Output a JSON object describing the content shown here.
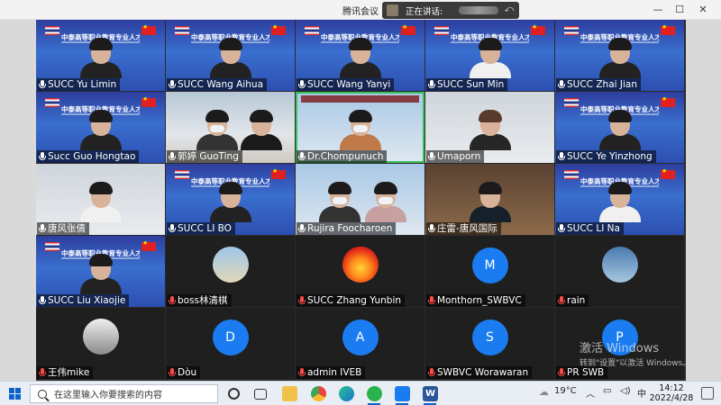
{
  "window": {
    "title": "腾讯会议",
    "speaking_label": "正在讲话:"
  },
  "watermark": {
    "line1": "激活 Windows",
    "line2": "转到\"设置\"以激活 Windows。"
  },
  "banner": {
    "title": "中泰高等职业教育专业人才培养方案研讨会"
  },
  "participants": [
    {
      "name": "SUCC Yu Limin",
      "muted": false
    },
    {
      "name": "SUCC Wang Aihua",
      "muted": false
    },
    {
      "name": "SUCC Wang Yanyi",
      "muted": false
    },
    {
      "name": "SUCC Sun Min",
      "muted": false
    },
    {
      "name": "SUCC Zhai Jian",
      "muted": false
    },
    {
      "name": "Succ Guo Hongtao",
      "muted": false
    },
    {
      "name": "郭婷 GuoTing",
      "muted": false
    },
    {
      "name": "Dr.Chompunuch",
      "muted": false
    },
    {
      "name": "Umaporn",
      "muted": false
    },
    {
      "name": "SUCC Ye Yinzhong",
      "muted": false
    },
    {
      "name": "唐风张倩",
      "muted": false
    },
    {
      "name": "SUCC LI BO",
      "muted": false
    },
    {
      "name": "Rujira Foocharoen",
      "muted": false
    },
    {
      "name": "庄雷-唐风国际",
      "muted": false
    },
    {
      "name": "SUCC LI Na",
      "muted": false
    },
    {
      "name": "SUCC Liu Xiaojie",
      "muted": false
    },
    {
      "name": "boss林清棋",
      "muted": true
    },
    {
      "name": "SUCC Zhang Yunbin",
      "muted": true
    },
    {
      "name": "Monthorn_SWBVC",
      "muted": true,
      "initial": "M"
    },
    {
      "name": "rain",
      "muted": true
    },
    {
      "name": "王伟mike",
      "muted": true
    },
    {
      "name": "Dòu",
      "muted": true,
      "initial": "D"
    },
    {
      "name": "admin IVEB",
      "muted": true,
      "initial": "A"
    },
    {
      "name": "SWBVC Worawaran",
      "muted": true,
      "initial": "S"
    },
    {
      "name": "PR SWB",
      "muted": true,
      "initial": "P"
    }
  ],
  "taskbar": {
    "search_placeholder": "在这里输入你要搜索的内容",
    "temperature": "19°C",
    "ime": "中",
    "time": "14:12",
    "date": "2022/4/28"
  },
  "colors": {
    "avatar_blue": "#1a7cf0",
    "banner_blue": "#2d3e9f"
  }
}
